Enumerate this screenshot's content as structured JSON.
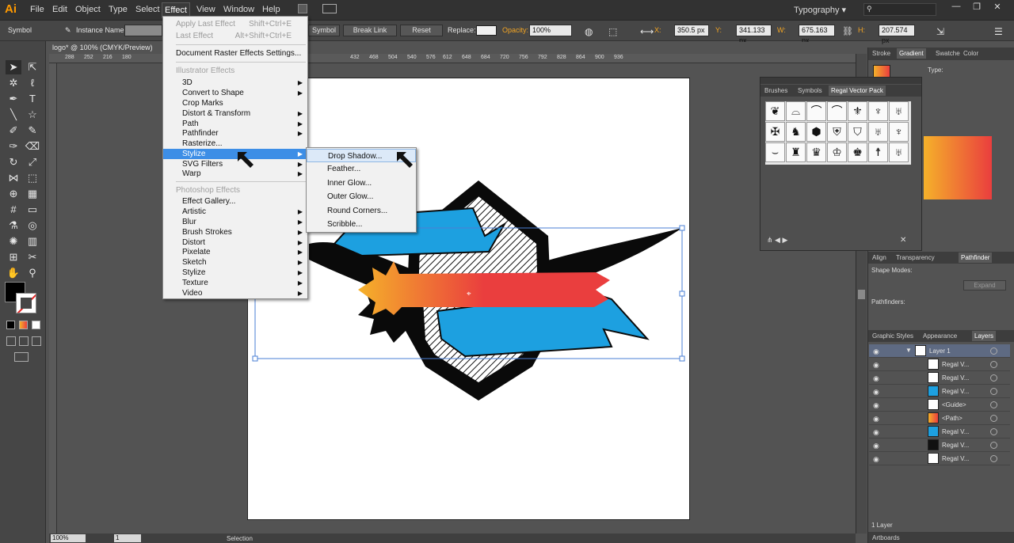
{
  "app": {
    "logo": "Ai",
    "menus": [
      "File",
      "Edit",
      "Object",
      "Type",
      "Select",
      "Effect",
      "View",
      "Window",
      "Help"
    ],
    "active_menu": "Effect",
    "workspace": "Typography",
    "window_buttons": [
      "—",
      "❐",
      "✕"
    ]
  },
  "control": {
    "selection": "Symbol",
    "instance_label": "Instance Name:",
    "symbol_btn": "Symbol",
    "break_link": "Break Link",
    "reset": "Reset",
    "replace": "Replace:",
    "opacity_label": "Opacity:",
    "opacity": "100%",
    "x_label": "X:",
    "x": "350.5 px",
    "y_label": "Y:",
    "y": "341.133 px",
    "w_label": "W:",
    "w": "675.163 px",
    "h_label": "H:",
    "h": "207.574 px"
  },
  "document": {
    "tab": "logo* @ 100% (CMYK/Preview)",
    "ruler": [
      "288",
      "252",
      "216",
      "180",
      "612",
      "648",
      "684",
      "720",
      "756",
      "792",
      "828",
      "864",
      "900",
      "936"
    ],
    "ruler_mid": [
      "432",
      "468",
      "504",
      "540",
      "576"
    ],
    "zoom": "100%",
    "artboard": "1",
    "status": "Selection"
  },
  "effect_menu": {
    "apply_last": "Apply Last Effect",
    "apply_last_sc": "Shift+Ctrl+E",
    "last": "Last Effect",
    "last_sc": "Alt+Shift+Ctrl+E",
    "doc_raster": "Document Raster Effects Settings...",
    "ill_header": "Illustrator Effects",
    "ill_items": [
      "3D",
      "Convert to Shape",
      "Crop Marks",
      "Distort & Transform",
      "Path",
      "Pathfinder",
      "Rasterize...",
      "Stylize",
      "SVG Filters",
      "Warp"
    ],
    "ps_header": "Photoshop Effects",
    "ps_items": [
      "Effect Gallery...",
      "Artistic",
      "Blur",
      "Brush Strokes",
      "Distort",
      "Pixelate",
      "Sketch",
      "Stylize",
      "Texture",
      "Video"
    ]
  },
  "stylize_submenu": [
    "Drop Shadow...",
    "Feather...",
    "Inner Glow...",
    "Outer Glow...",
    "Round Corners...",
    "Scribble..."
  ],
  "panels": {
    "top_tabs": [
      "Stroke",
      "Gradient",
      "Swatche",
      "Color"
    ],
    "type_label": "Type:",
    "brush_tabs": [
      "Brushes",
      "Symbols",
      "Regal Vector Pack"
    ],
    "align_tabs": [
      "Align",
      "Transparency",
      "Pathfinder"
    ],
    "shape_modes": "Shape Modes:",
    "expand": "Expand",
    "pathfinders": "Pathfinders:",
    "layer_tabs": [
      "Graphic Styles",
      "Appearance",
      "Layers"
    ],
    "layers": [
      "Layer 1",
      "Regal V...",
      "Regal V...",
      "Regal V...",
      "<Guide>",
      "<Path>",
      "Regal V...",
      "Regal V...",
      "Regal V..."
    ],
    "layer_count": "1 Layer",
    "artboards": "Artboards"
  },
  "colors": {
    "gradient_start": "#f5b12a",
    "gradient_end": "#ea3e3e",
    "banner_blue": "#1da0e0",
    "menu_highlight": "#3d8ee6"
  }
}
